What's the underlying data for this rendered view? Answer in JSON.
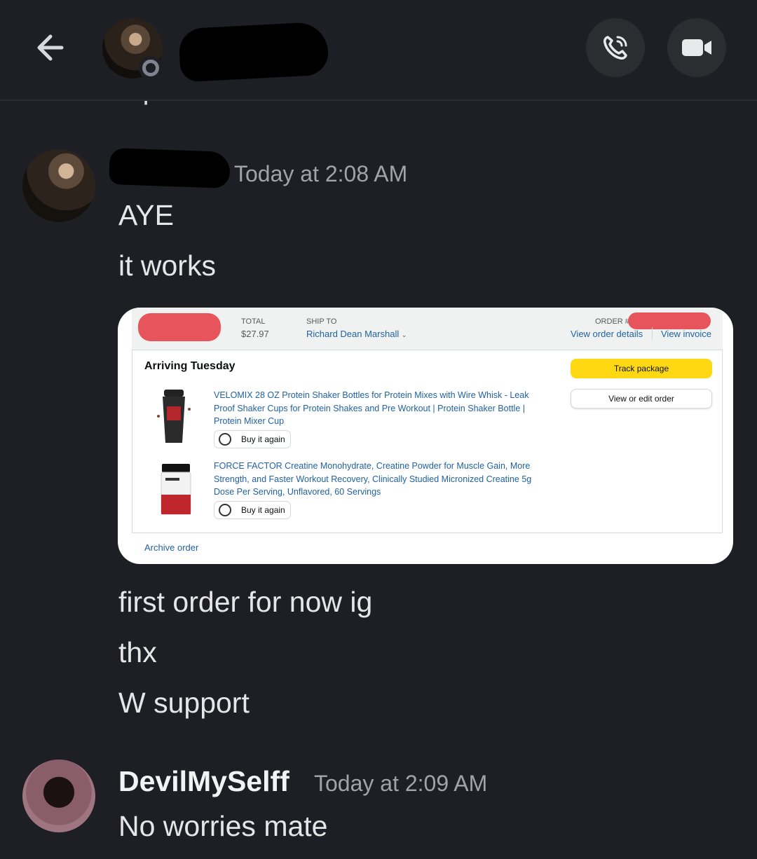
{
  "header": {
    "back_icon": "arrow-left-icon",
    "call_icon": "phone-call-icon",
    "video_icon": "video-camera-icon",
    "cut_off_text": "replacement"
  },
  "messages": [
    {
      "timestamp": "Today at 2:08 AM",
      "lines": [
        "AYE",
        "it works",
        "first order for now ig",
        "thx",
        "W support"
      ]
    },
    {
      "author": "DevilMySelff",
      "timestamp": "Today at 2:09 AM",
      "lines": [
        "No worries mate"
      ]
    }
  ],
  "order": {
    "total_label": "TOTAL",
    "total_value": "$27.97",
    "ship_label": "SHIP TO",
    "ship_value": "Richard Dean Marshall",
    "order_label": "ORDER #",
    "view_details": "View order details",
    "view_invoice": "View invoice",
    "arriving": "Arriving Tuesday",
    "track": "Track package",
    "edit": "View or edit order",
    "items": [
      {
        "title": "VELOMIX 28 OZ Protein Shaker Bottles for Protein Mixes with Wire Whisk - Leak Proof Shaker Cups for Protein Shakes and Pre Workout | Protein Shaker Bottle | Protein Mixer Cup",
        "buy_again": "Buy it again"
      },
      {
        "title": "FORCE FACTOR Creatine Monohydrate, Creatine Powder for Muscle Gain, More Strength, and Faster Workout Recovery, Clinically Studied Micronized Creatine 5g Dose Per Serving, Unflavored, 60 Servings",
        "buy_again": "Buy it again"
      }
    ],
    "archive": "Archive order",
    "link_color": "#2162a1",
    "track_color": "#ffd814",
    "redaction_color": "#e8545c"
  },
  "colors": {
    "background": "#1e1f24",
    "button_bg": "#2b2d31",
    "timestamp": "#a1a3a8"
  }
}
